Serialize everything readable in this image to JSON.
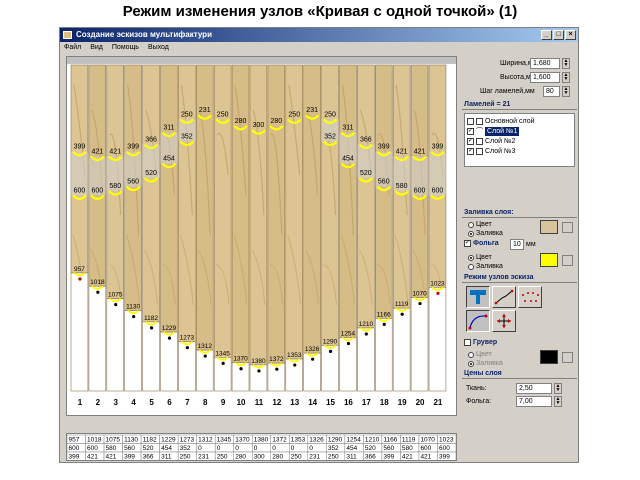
{
  "slide": {
    "title": "Режим изменения узлов «Кривая с одной точкой» (1)"
  },
  "window": {
    "title": "Создание эскизов мультифактури",
    "menu": [
      "Файл",
      "Вид",
      "Помощь",
      "Выход"
    ]
  },
  "colors": {
    "accent": "#0a246a",
    "node_ring": "#ffff00",
    "lamella": "#d9c08a",
    "foil_swatch": "#ffff00",
    "fill_swatch": "#d8c49a",
    "groove_swatch": "#000000"
  },
  "lamellas": {
    "numbers": [
      "1",
      "2",
      "3",
      "4",
      "5",
      "6",
      "7",
      "8",
      "9",
      "10",
      "11",
      "12",
      "13",
      "14",
      "15",
      "16",
      "17",
      "18",
      "19",
      "20",
      "21"
    ],
    "top_values": [
      399,
      421,
      421,
      399,
      366,
      311,
      250,
      231,
      250,
      280,
      300,
      280,
      250,
      231,
      250,
      311,
      366,
      399,
      421,
      421,
      399
    ],
    "second_values": [
      600,
      600,
      580,
      560,
      520,
      454,
      352,
      null,
      null,
      null,
      null,
      null,
      null,
      null,
      352,
      454,
      520,
      560,
      580,
      600,
      600
    ],
    "bottom_values": [
      957,
      1018,
      1075,
      1130,
      1182,
      1229,
      1273,
      1312,
      1345,
      1370,
      1380,
      1372,
      1353,
      1326,
      1290,
      1254,
      1210,
      1166,
      1119,
      1070,
      1023
    ]
  },
  "table": {
    "rows": [
      [
        "957",
        "1018",
        "1075",
        "1130",
        "1182",
        "1229",
        "1273",
        "1312",
        "1345",
        "1370",
        "1380",
        "1372",
        "1353",
        "1326",
        "1290",
        "1254",
        "1210",
        "1166",
        "1119",
        "1070",
        "1023"
      ],
      [
        "600",
        "600",
        "580",
        "560",
        "520",
        "454",
        "352",
        "0",
        "0",
        "0",
        "0",
        "0",
        "0",
        "0",
        "352",
        "454",
        "520",
        "560",
        "580",
        "600",
        "600"
      ],
      [
        "399",
        "421",
        "421",
        "399",
        "366",
        "311",
        "250",
        "231",
        "250",
        "280",
        "300",
        "280",
        "250",
        "231",
        "250",
        "311",
        "366",
        "399",
        "421",
        "421",
        "399"
      ]
    ]
  },
  "panel": {
    "width_label": "Ширина,м",
    "width_value": "1,680",
    "height_label": "Высота,м",
    "height_value": "1,600",
    "step_label": "Шаг ламелей,мм",
    "step_value": "80",
    "lamellas_header": "Ламелей = 21",
    "layers": [
      {
        "label": "Основной слой",
        "checked": false
      },
      {
        "label": "Слой №1",
        "checked": true
      },
      {
        "label": "Слой №2",
        "checked": true
      },
      {
        "label": "Слой №3",
        "checked": true
      }
    ],
    "fill_header": "Заливка слоя:",
    "fill_options": [
      "Цвет",
      "Заливка"
    ],
    "foil_label": "Фольга",
    "foil_value": "10",
    "foil_unit": "мм",
    "foil_options": [
      "Цвет",
      "Заливка"
    ],
    "mode_header": "Режим узлов эскиза",
    "groove_label": "Грувер",
    "groove_options": [
      "Цвет",
      "Заливка"
    ],
    "prices_header": "Цены слоя",
    "fabric_label": "Ткань:",
    "fabric_value": "2,50",
    "foil_price_label": "Фольга:",
    "foil_price_value": "7,00"
  }
}
